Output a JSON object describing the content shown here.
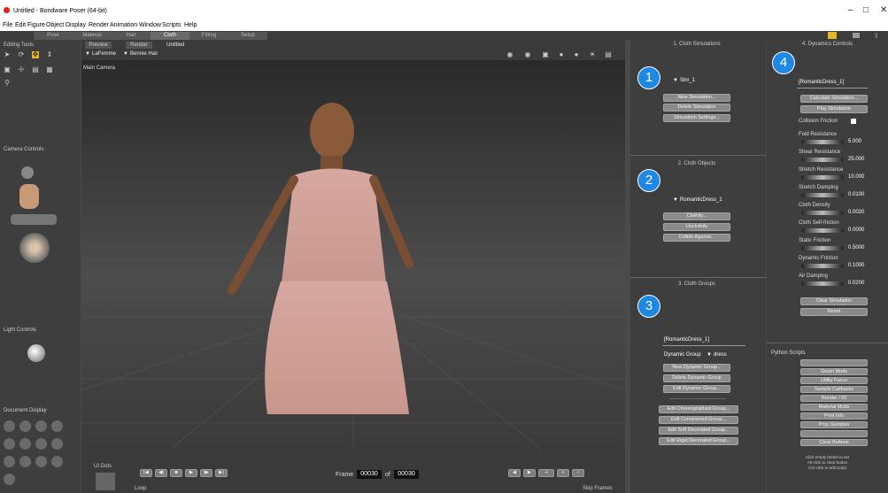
{
  "app": {
    "title": "Untitled - Bondware Poser (64-bit)"
  },
  "menu": [
    "File",
    "Edit",
    "Figure",
    "Object",
    "Display",
    "Render",
    "Animation",
    "Window",
    "Scripts",
    "Help"
  ],
  "rooms": [
    "Pose",
    "Material",
    "Hair",
    "Cloth",
    "Fitting",
    "Setup"
  ],
  "left": {
    "editing_tools": "Editing Tools",
    "camera_controls": "Camera Controls",
    "light_controls": "Light Controls",
    "document_display": "Document Display"
  },
  "doc": {
    "tabs": [
      "Preview",
      "Render",
      "Untitled"
    ],
    "figure_select": "LaFemme",
    "actor_select": "Bennie Hair",
    "camera": "Main Camera"
  },
  "timeline": {
    "ui_dots": "UI Dots",
    "frame_label": "Frame",
    "frame": "00030",
    "of_label": "of",
    "total": "00030",
    "loop": "Loop",
    "skip_frames": "Skip Frames"
  },
  "cloth": {
    "sim_header": "1. Cloth Simulations",
    "sim_name": "Sim_1",
    "new_sim": "New Simulation...",
    "delete_sim": "Delete Simulation",
    "sim_settings": "Simulation Settings...",
    "objects_header": "2. Cloth Objects",
    "object_name": "RomanticDress_1",
    "clothify": "Clothify...",
    "unclothify": "Unclothify",
    "collide": "Collide Against...",
    "groups_header": "3. Cloth Groups",
    "group_object": "[RomanticDress_1]",
    "dynamic_group_label": "Dynamic Group",
    "dynamic_group_value": "dress",
    "new_dyn": "New Dynamic Group...",
    "del_dyn": "Delete Dynamic Group",
    "edit_dyn": "Edit Dynamic Group...",
    "edit_chor": "Edit Choreographed Group...",
    "edit_constr": "Edit Constrained Group...",
    "edit_soft": "Edit Soft Decorated Group...",
    "edit_rigid": "Edit Rigid Decorated Group...",
    "num1": "1",
    "num2": "2",
    "num3": "3",
    "num4": "4"
  },
  "dynamics": {
    "header": "4. Dynamics Controls",
    "object": "[RomanticDress_1]",
    "calculate": "Calculate Simulation...",
    "play": "Play Simulation",
    "collision_friction": "Collision Friction",
    "params": [
      {
        "label": "Fold Resistance",
        "value": "5.000"
      },
      {
        "label": "Shear Resistance",
        "value": "25.000"
      },
      {
        "label": "Stretch Resistance",
        "value": "10.000"
      },
      {
        "label": "Stretch Damping",
        "value": "0.0100"
      },
      {
        "label": "Cloth Density",
        "value": "0.0020"
      },
      {
        "label": "Cloth Self-friction",
        "value": "0.0000"
      },
      {
        "label": "Static Friction",
        "value": "0.5000"
      },
      {
        "label": "Dynamic Friction",
        "value": "0.1000"
      },
      {
        "label": "Air Damping",
        "value": "0.0200"
      }
    ],
    "clear": "Clear Simulation",
    "reset": "Reset"
  },
  "python": {
    "header": "Python Scripts",
    "buttons": [
      "",
      "Geom Mods",
      "Utility Funcs",
      "Sample Callbacks",
      "Render / IO",
      "Material Mods",
      "Print Info",
      "Prop Samples",
      "",
      "Clear Buttons"
    ],
    "note1": "Click empty button to set",
    "note2": "Alt-click to clear button",
    "note3": "Ctrl-click to edit script"
  }
}
